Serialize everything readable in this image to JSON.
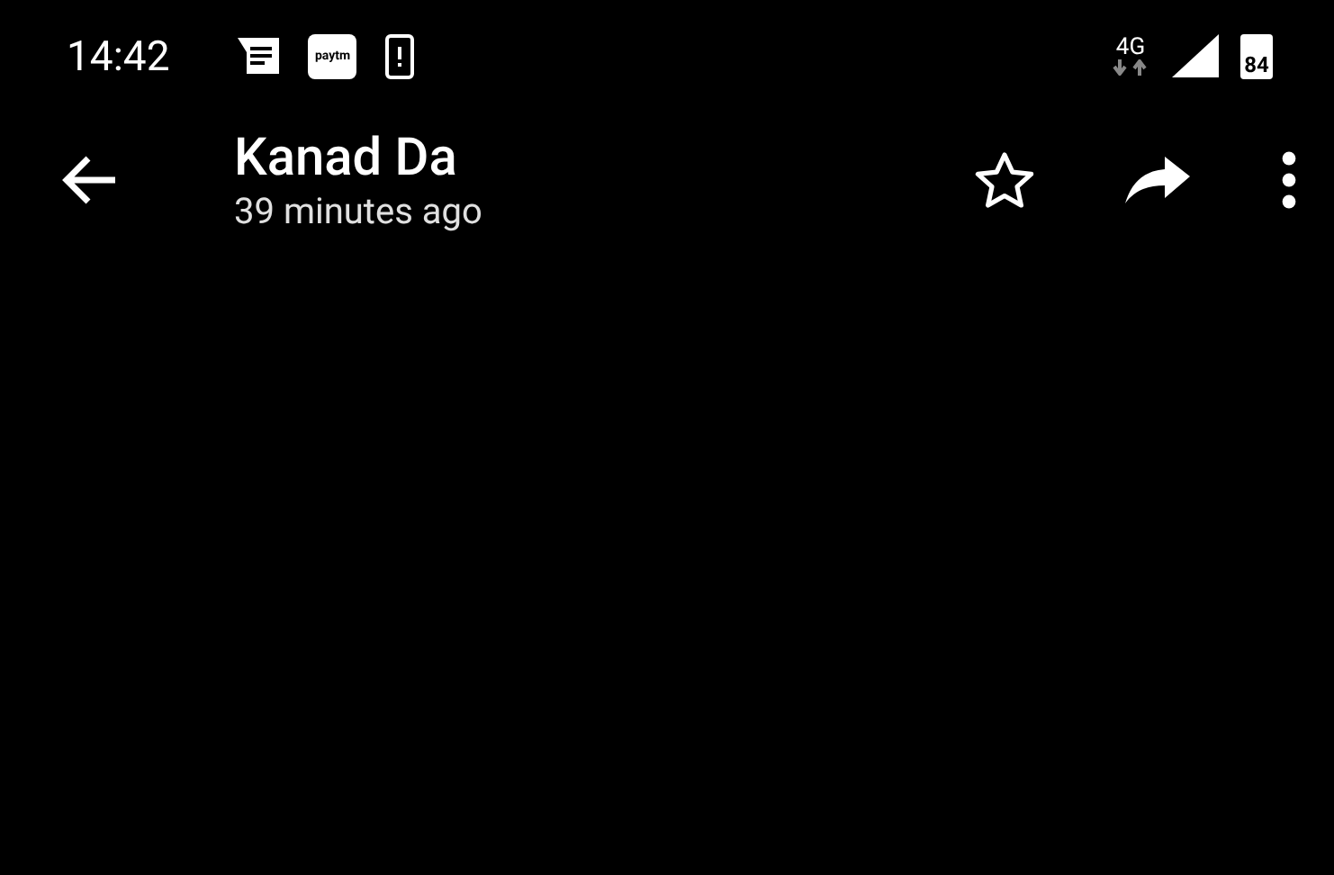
{
  "status_bar": {
    "time": "14:42",
    "paytm_label": "paytm",
    "network": "4G",
    "battery": "84"
  },
  "toolbar": {
    "title": "Kanad Da",
    "subtitle": "39 minutes ago",
    "starred": false
  }
}
